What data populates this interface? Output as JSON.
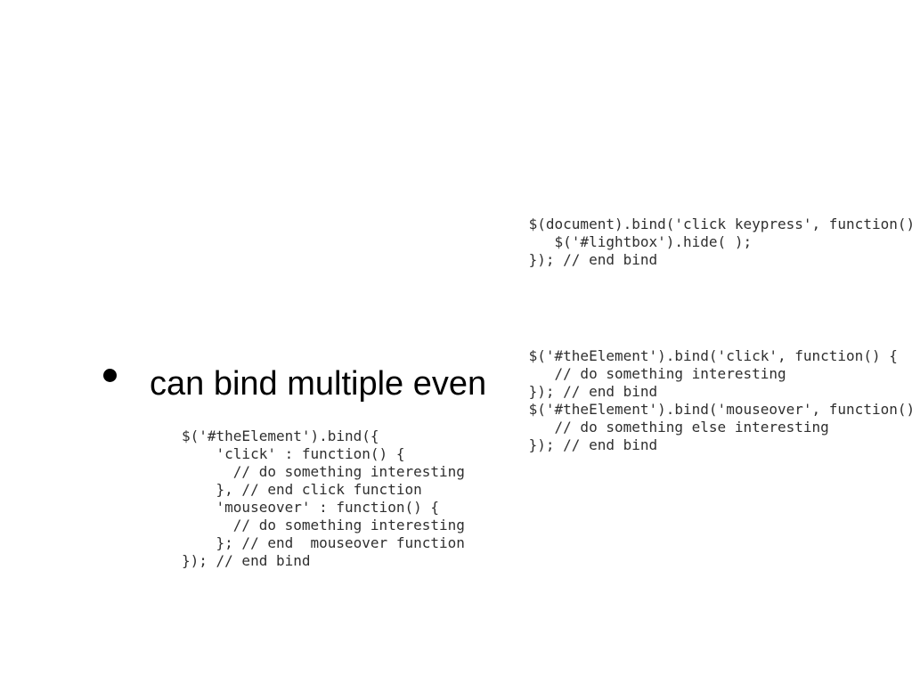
{
  "bullet": {
    "text": "can bind multiple even"
  },
  "code_top_right": " $(document).bind('click keypress', function() {\n    $('#lightbox').hide( );\n }); // end bind",
  "code_mid_right": " $('#theElement').bind('click', function() {\n    // do something interesting\n }); // end bind\n $('#theElement').bind('mouseover', function() {\n    // do something else interesting\n }); // end bind",
  "code_bottom_left": "$('#theElement').bind({\n    'click' : function() {\n      // do something interesting\n    }, // end click function\n    'mouseover' : function() {\n      // do something interesting\n    }; // end  mouseover function\n}); // end bind"
}
